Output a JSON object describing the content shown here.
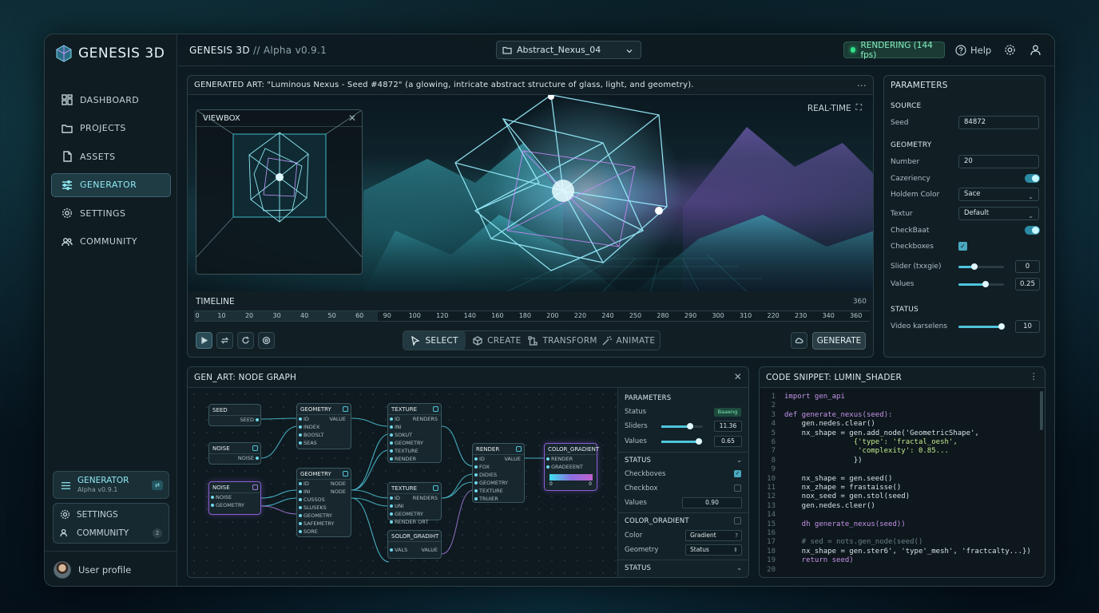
{
  "app": {
    "name": "GENESIS 3D",
    "title": "GENESIS 3D",
    "version": "// Alpha v0.9.1"
  },
  "sidebar": {
    "items": [
      {
        "label": "DASHBOARD",
        "icon": "dashboard-icon"
      },
      {
        "label": "PROJECTS",
        "icon": "folder-icon"
      },
      {
        "label": "ASSETS",
        "icon": "file-icon"
      },
      {
        "label": "GENERATOR",
        "icon": "sliders-icon",
        "active": true
      },
      {
        "label": "SETTINGS",
        "icon": "gear-icon"
      },
      {
        "label": "COMMUNITY",
        "icon": "users-icon"
      }
    ],
    "gen_card": {
      "title": "GENERATOR",
      "sub": "Alpha v0.9.1"
    },
    "settings_card": {
      "settings": "SETTINGS",
      "community": "COMMUNITY",
      "count": "2"
    },
    "user": "User profile"
  },
  "topbar": {
    "project": "Abstract_Nexus_04",
    "status": "RENDERING (144 fps)",
    "help": "Help"
  },
  "art": {
    "header": "GENERATED ART: \"Luminous Nexus - Seed #4872\" (a glowing, intricate abstract structure of glass, light, and geometry).",
    "realtime": "REAL-TIME",
    "viewbox": "VIEWBOX",
    "timeline_label": "TIMELINE",
    "timeline_end": "360",
    "ticks": [
      "0",
      "10",
      "20",
      "30",
      "40",
      "50",
      "60",
      "90",
      "100",
      "120",
      "140",
      "160",
      "180",
      "200",
      "220",
      "240",
      "250",
      "280",
      "290",
      "300",
      "310",
      "220",
      "230",
      "340",
      "360"
    ],
    "modes": [
      "SELECT",
      "CREATE",
      "TRANSFORM",
      "ANIMATE"
    ],
    "generate": "GENERATE"
  },
  "params": {
    "title": "PARAMETERS",
    "source": "SOURCE",
    "seed_label": "Seed",
    "seed": "84872",
    "geometry": "GEOMETRY",
    "number_label": "Number",
    "number": "20",
    "cazeriency": "Cazeriency",
    "holdem_label": "Holdem Color",
    "holdem": "Sace",
    "textur_label": "Textur",
    "textur": "Default",
    "checkbaat": "CheckBaat",
    "checkboxes": "Checkboxes",
    "slider_label": "Slider (txxgie)",
    "slider_val": "0",
    "slider_pct": 0.35,
    "values_label": "Values",
    "values_val": "0.25",
    "values_pct": 0.6,
    "status": "STATUS",
    "video_label": "Video karselens",
    "video_val": "10",
    "video_pct": 0.95
  },
  "nodegraph": {
    "title": "GEN_ART: NODE GRAPH",
    "nodes": {
      "seed": {
        "title": "SEED",
        "out": "SEED"
      },
      "noise1": {
        "title": "NOISE",
        "out": "NOISE"
      },
      "noise2": {
        "title": "NOISE",
        "ports": [
          "NOISE",
          "GEOMETRY"
        ]
      },
      "geo1": {
        "title": "GEOMETRY",
        "ports": [
          "ID",
          "INDEX",
          "BOOSLT",
          "SEAS"
        ],
        "out": "VALUE"
      },
      "geo2": {
        "title": "GEOMETRY",
        "ports": [
          "ID",
          "INI",
          "CUSSOS",
          "SLUSEKS",
          "GEOMETRY",
          "SAFEMETRY",
          "SORE"
        ],
        "outs": [
          "NODE",
          "NODE"
        ]
      },
      "tex1": {
        "title": "TEXTURE",
        "ports": [
          "ID",
          "INI",
          "SOKUT",
          "GEOMETRY",
          "TEXTURE",
          "RENDER"
        ],
        "out": "RENDERS"
      },
      "tex2": {
        "title": "TEXTURE",
        "ports": [
          "ID",
          "UNI",
          "GEOMETRY",
          "RENDER ORT"
        ],
        "out": "RENDERS"
      },
      "solor": {
        "title": "SOLOR_GRADIHT",
        "ports": [
          "VALS"
        ],
        "out": "VALUE"
      },
      "render": {
        "title": "RENDER",
        "ports": [
          "ID",
          "FOX",
          "DIDIES",
          "GEOMETRY",
          "TEXTURE",
          "TRUIER"
        ],
        "out": "VALUE"
      },
      "grad": {
        "title": "COLOR_GRADIENT",
        "ports": [
          "RENDER",
          "GRADEEENT"
        ],
        "min": "0",
        "max": "0"
      }
    },
    "panel": {
      "params": "PARAMETERS",
      "status_label": "Status",
      "status_badge": "Baaeng",
      "sliders_label": "Sliders",
      "sliders_val": "11.36",
      "sliders_pct": 0.7,
      "values_label": "Values",
      "values_val": "0.65",
      "values_pct": 0.9,
      "status": "STATUS",
      "checkboves": "Checkboves",
      "checkbox": "Checkbox",
      "values2_label": "Values",
      "values2_val": "0.90",
      "color_grad": "COLOR_ORADIENT",
      "color_label": "Color",
      "color_val": "Gradient",
      "geometry_label": "Geometry",
      "geometry_val": "Status",
      "status2": "STATUS"
    }
  },
  "code": {
    "title": "CODE SNIPPET: LUMIN_SHADER",
    "lines": [
      "import gen_api",
      "",
      "def generate_nexus(seed):",
      "    gen.nedes.clear()",
      "    nx_shape = gen.add_node('GeometricShape',",
      "                {'type': 'fractal_oesh',",
      "                 'complexity': 0.85...",
      "                })",
      "",
      "    nx_shape = gen.seed()",
      "    nx_zhape = frastaisse()",
      "    nox_seed = gen.stol(seed)",
      "    gen.nedes.cleer()",
      "",
      "    dh generate_nexus(seed))",
      "",
      "    # sed = nots.gen_node(seed()",
      "    nx_shape = gen.ster6', 'type'_mesh', 'fractcalty...})",
      "    return seed)",
      ""
    ]
  }
}
